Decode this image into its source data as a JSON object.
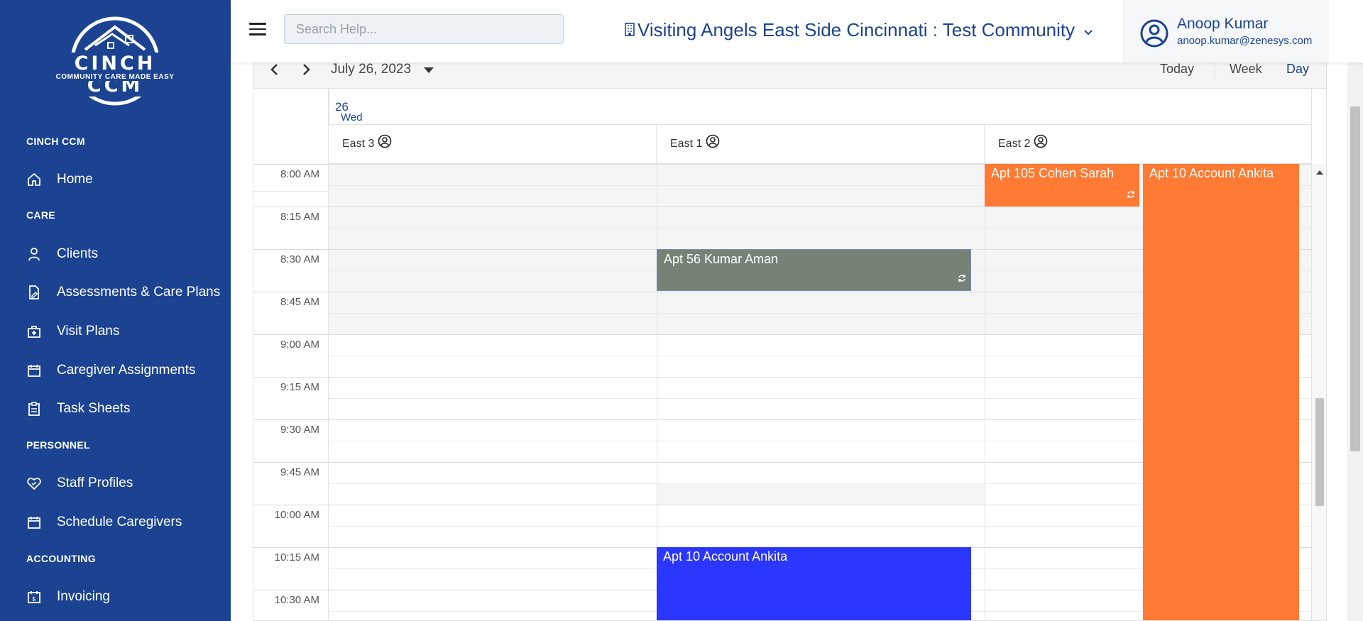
{
  "logo": {
    "title": "CINCH CCM",
    "subtitle": "COMMUNITY CARE MADE EASY"
  },
  "sidebar": {
    "sections": [
      {
        "title": "CINCH CCM",
        "items": [
          {
            "label": "Home",
            "icon": "home-icon"
          }
        ]
      },
      {
        "title": "CARE",
        "items": [
          {
            "label": "Clients",
            "icon": "user-icon"
          },
          {
            "label": "Assessments & Care Plans",
            "icon": "document-edit-icon"
          },
          {
            "label": "Visit Plans",
            "icon": "medical-bag-icon"
          },
          {
            "label": "Caregiver Assignments",
            "icon": "calendar-icon"
          },
          {
            "label": "Task Sheets",
            "icon": "clipboard-icon"
          }
        ]
      },
      {
        "title": "PERSONNEL",
        "items": [
          {
            "label": "Staff Profiles",
            "icon": "heart-shield-icon"
          },
          {
            "label": "Schedule Caregivers",
            "icon": "calendar-icon"
          }
        ]
      },
      {
        "title": "ACCOUNTING",
        "items": [
          {
            "label": "Invoicing",
            "icon": "invoice-icon"
          }
        ]
      }
    ]
  },
  "header": {
    "search_placeholder": "Search Help...",
    "community": "Visiting Angels East Side Cincinnati : Test Community",
    "user_name": "Anoop Kumar",
    "user_email": "anoop.kumar@zenesys.com"
  },
  "calendar": {
    "date_label": "July 26, 2023",
    "views": [
      "Today",
      "Week",
      "Day"
    ],
    "active_view": "Day",
    "day_header": {
      "weekday": "Wed",
      "day": "26"
    },
    "resources": [
      "East 3",
      "East 1",
      "East 2"
    ],
    "time_slots": [
      "8:00 AM",
      "8:15 AM",
      "8:30 AM",
      "8:45 AM",
      "9:00 AM",
      "9:15 AM",
      "9:30 AM",
      "9:45 AM",
      "10:00 AM",
      "10:15 AM",
      "10:30 AM"
    ],
    "events": [
      {
        "title": "Apt 105 Cohen Sarah",
        "resource": "East 2",
        "start": "8:00 AM",
        "end": "8:15 AM",
        "color": "#ff7a33",
        "recurring": true
      },
      {
        "title": "Apt 10 Account Ankita",
        "resource": "East 2",
        "start": "8:00 AM",
        "end": "10:30 AM+",
        "color": "#ff7a33",
        "recurring": false
      },
      {
        "title": "Apt 56 Kumar Aman",
        "resource": "East 1",
        "start": "8:30 AM",
        "end": "8:45 AM",
        "color": "#768276",
        "recurring": true
      },
      {
        "title": "Apt 10 Account Ankita",
        "resource": "East 1",
        "start": "10:15 AM",
        "end": "10:30 AM+",
        "color": "#2b36ff",
        "recurring": false
      }
    ]
  },
  "colors": {
    "sidebar": "#1b4391",
    "accent": "#1b4391",
    "orange_event": "#ff7a33",
    "gray_event": "#768276",
    "blue_event": "#2b36ff"
  }
}
